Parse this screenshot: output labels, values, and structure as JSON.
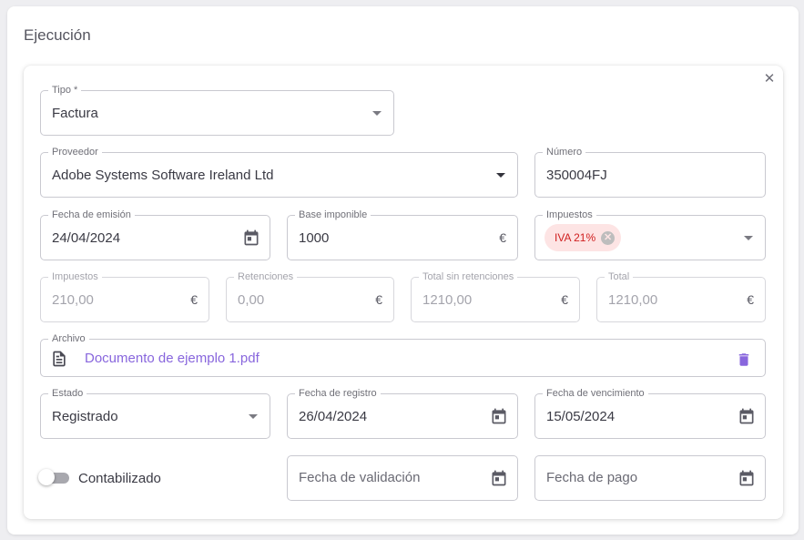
{
  "section": {
    "title": "Ejecución"
  },
  "form": {
    "close_icon": "close-icon",
    "tipo": {
      "label": "Tipo *",
      "value": "Factura"
    },
    "proveedor": {
      "label": "Proveedor",
      "value": "Adobe Systems Software Ireland Ltd"
    },
    "numero": {
      "label": "Número",
      "value": "350004FJ"
    },
    "fecha_emision": {
      "label": "Fecha de emisión",
      "value": "24/04/2024"
    },
    "base_imponible": {
      "label": "Base imponible",
      "value": "1000",
      "suffix": "€"
    },
    "impuestos_select": {
      "label": "Impuestos",
      "chips": [
        "IVA 21%"
      ]
    },
    "impuestos_total": {
      "label": "Impuestos",
      "value": "210,00",
      "suffix": "€"
    },
    "retenciones": {
      "label": "Retenciones",
      "value": "0,00",
      "suffix": "€"
    },
    "total_sin_retenciones": {
      "label": "Total sin retenciones",
      "value": "1210,00",
      "suffix": "€"
    },
    "total": {
      "label": "Total",
      "value": "1210,00",
      "suffix": "€"
    },
    "archivo": {
      "label": "Archivo",
      "value": "Documento de ejemplo 1.pdf"
    },
    "estado": {
      "label": "Estado",
      "value": "Registrado"
    },
    "fecha_registro": {
      "label": "Fecha de registro",
      "value": "26/04/2024"
    },
    "fecha_vencimiento": {
      "label": "Fecha de vencimiento",
      "value": "15/05/2024"
    },
    "contabilizado": {
      "label": "Contabilizado",
      "checked": false
    },
    "fecha_validacion": {
      "placeholder": "Fecha de validación"
    },
    "fecha_pago": {
      "placeholder": "Fecha de pago"
    }
  },
  "colors": {
    "accent_link": "#8866dd",
    "chip_bg": "#fde4e4",
    "chip_text": "#d02020",
    "border": "#c9c9d0"
  }
}
